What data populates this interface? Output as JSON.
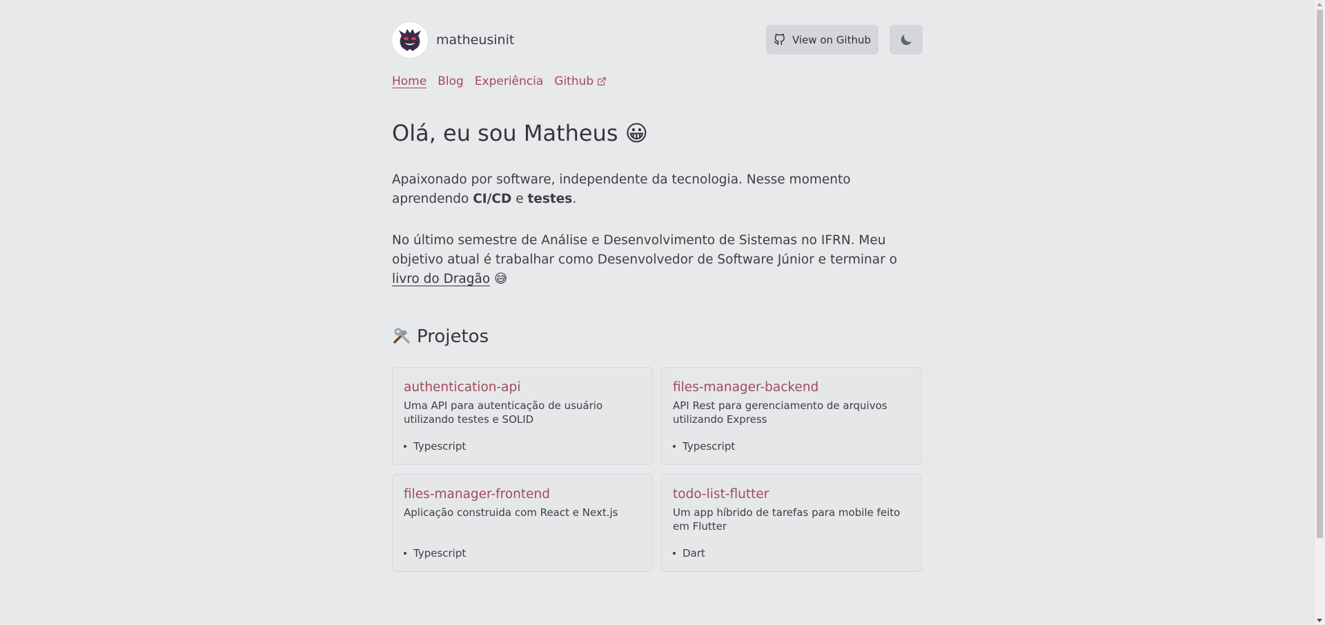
{
  "header": {
    "brand_name": "matheusinit",
    "github_button_label": "View on Github"
  },
  "nav": {
    "items": [
      {
        "label": "Home"
      },
      {
        "label": "Blog"
      },
      {
        "label": "Experiência"
      },
      {
        "label": "Github"
      }
    ]
  },
  "hero": {
    "title": "Olá, eu sou Matheus 😀",
    "intro_prefix": "Apaixonado por software, independente da tecnologia. Nesse momento aprendendo ",
    "intro_bold1": "CI/CD",
    "intro_mid": " e ",
    "intro_bold2": "testes",
    "intro_end": ".",
    "para2_text": "No último semestre de Análise e Desenvolvimento de Sistemas no IFRN. Meu objetivo atual é trabalhar como Desenvolvedor de Software Júnior e terminar o ",
    "para2_link": "livro do Dragão",
    "para2_emoji": " 😅"
  },
  "projects": {
    "heading": "Projetos",
    "items": [
      {
        "name": "authentication-api",
        "description": "Uma API para autenticação de usuário utilizando testes e SOLID",
        "language": "Typescript"
      },
      {
        "name": "files-manager-backend",
        "description": "API Rest para gerenciamento de arquivos utilizando Express",
        "language": "Typescript"
      },
      {
        "name": "files-manager-frontend",
        "description": "Aplicação construida com React e Next.js",
        "language": "Typescript"
      },
      {
        "name": "todo-list-flutter",
        "description": "Um app híbrido de tarefas para mobile feito em Flutter",
        "language": "Dart"
      }
    ]
  },
  "colors": {
    "background": "#e8e9eb",
    "accent": "#a14a5a",
    "button_bg": "#d4d6da"
  }
}
